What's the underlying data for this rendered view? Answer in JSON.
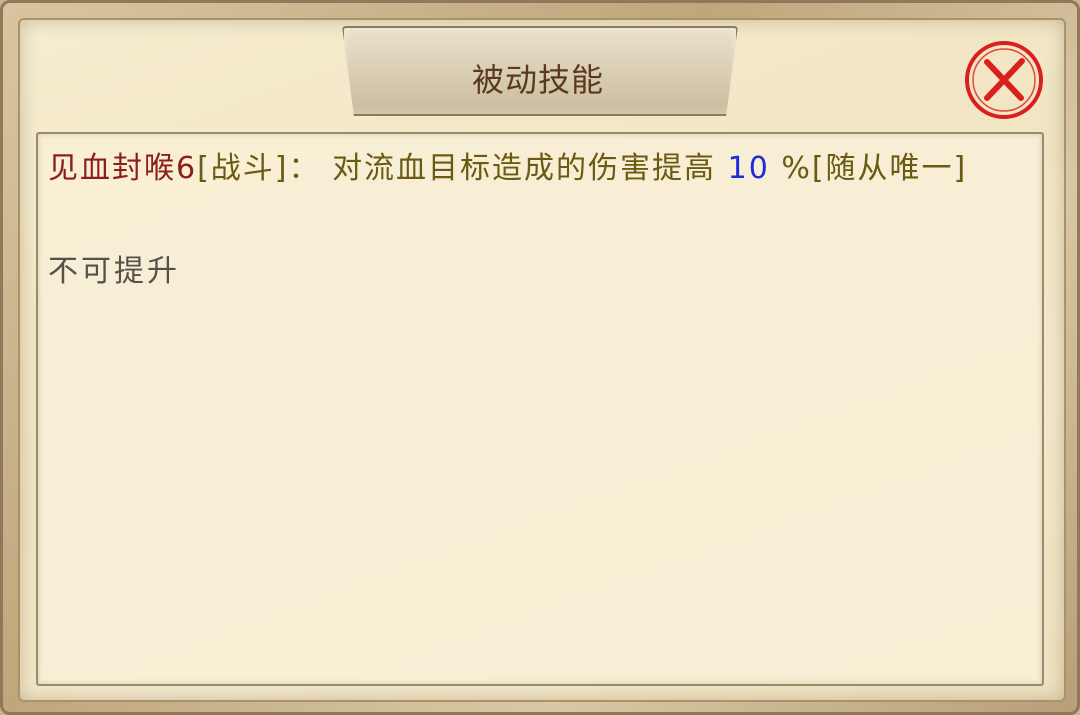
{
  "dialog": {
    "title": "被动技能",
    "close_icon": "close-x-icon",
    "accent_color": "#d9201f"
  },
  "skill": {
    "name": "见血封喉6",
    "tag": "[战斗]",
    "separator": "：",
    "description_prefix": "对流血目标造成的伤害提高",
    "value": "10",
    "description_suffix": "%[随从唯一]",
    "status": "不可提升"
  }
}
